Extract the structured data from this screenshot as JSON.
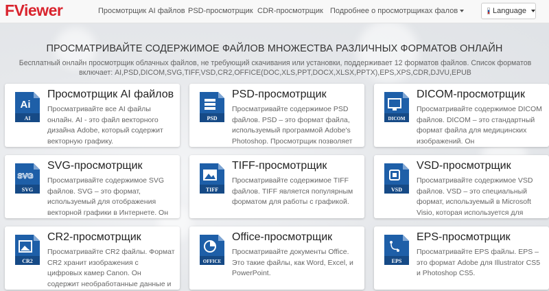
{
  "logo": {
    "text_main": "F",
    "text_v": "V",
    "text_rest": "iewer"
  },
  "nav": {
    "items": [
      {
        "label": "Просмотрщик AI файлов"
      },
      {
        "label": "PSD-просмотрщик"
      },
      {
        "label": "CDR-просмотрщик"
      },
      {
        "label": "Подробнее о просмотрщиках фалов"
      }
    ],
    "language_label": "Language"
  },
  "hero": {
    "headline": "ПРОСМАТРИВАЙТЕ СОДЕРЖИМОЕ ФАЙЛОВ МНОЖЕСТВА РАЗЛИЧНЫХ ФОРМАТОВ ОНЛАЙН",
    "description": "Бесплатный онлайн просмотрщик облачных файлов, не требующий скачивания или установки, поддерживает 12 форматов файлов. Список форматов включает: AI,PSD,DICOM,SVG,TIFF,VSD,CR2,OFFICE(DOC,XLS,PPT,DOCX,XLSX,PPTX),EPS,XPS,CDR,DJVU,EPUB"
  },
  "colors": {
    "brand": "#d9232d",
    "icon_blue": "#1e5fa8"
  },
  "cards": [
    {
      "title": "Просмотрщик AI файлов",
      "icon": "ai-file-icon",
      "badge": "AI",
      "glyph": "Ai",
      "text": "Просматривайте все AI файлы онлайн. AI - это файл векторного дизайна Adobe, который содержит векторную графику."
    },
    {
      "title": "PSD-просмотрщик",
      "icon": "psd-file-icon",
      "badge": "PSD",
      "glyph": "",
      "text": "Просматривайте содержимое PSD файлов. PSD – это формат файла, используемый программой Adobe's Photoshop. Просмотрщик позволяет"
    },
    {
      "title": "DICOM-просмотрщик",
      "icon": "dicom-file-icon",
      "badge": "DICOM",
      "glyph": "",
      "text": "Просматривайте содержимое DICOM файлов. DICOM – это стандартный формат файла для медицинских изображений. Он"
    },
    {
      "title": "SVG-просмотрщик",
      "icon": "svg-file-icon",
      "badge": "SVG",
      "glyph": "SVG",
      "text": "Просматривайте содержимое SVG файлов. SVG – это формат, используемый для отображения векторной графики в Интернете. Он"
    },
    {
      "title": "TIFF-просмотрщик",
      "icon": "tiff-file-icon",
      "badge": "TIFF",
      "glyph": "",
      "text": "Просматривайте содержимое TIFF файлов. TIFF является популярным форматом для работы с графикой."
    },
    {
      "title": "VSD-просмотрщик",
      "icon": "vsd-file-icon",
      "badge": "VSD",
      "glyph": "",
      "text": "Просматривайте содержимое VSD файлов. VSD – это специальный формат, используемый в Microsoft Visio, которая используется для"
    },
    {
      "title": "CR2-просмотрщик",
      "icon": "cr2-file-icon",
      "badge": "CR2",
      "glyph": "",
      "text": "Просматривайте CR2 файлы. Формат CR2 хранит изображения с цифровых камер Canon. Он содержит необработанные данные и"
    },
    {
      "title": "Office-просмотрщик",
      "icon": "office-file-icon",
      "badge": "OFFICE",
      "glyph": "",
      "text": "Просматривайте документы Office. Это такие файлы, как Word, Excel, и PowerPoint."
    },
    {
      "title": "EPS-просмотрщик",
      "icon": "eps-file-icon",
      "badge": "EPS",
      "glyph": "",
      "text": "Просматривайте EPS файлы. EPS – это формат Adobe для Illustrator CS5 и Photoshop CS5."
    }
  ]
}
